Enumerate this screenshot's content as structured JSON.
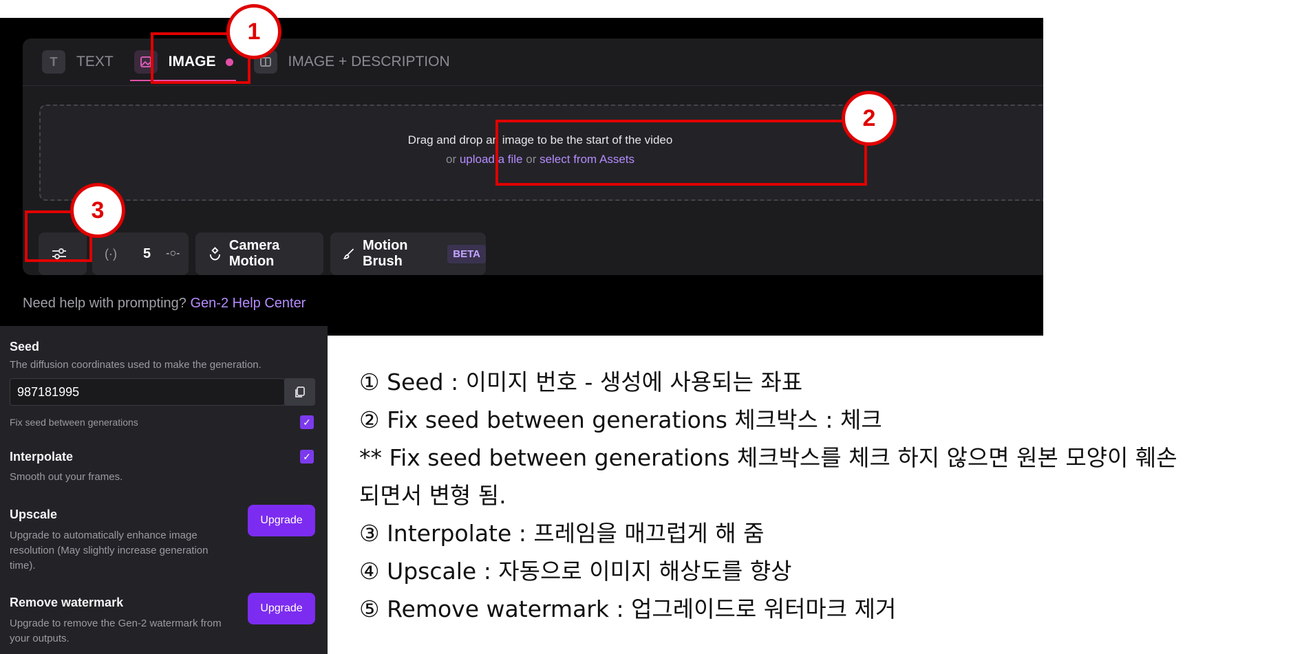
{
  "tabs": [
    {
      "label": "TEXT",
      "icon": "text-icon"
    },
    {
      "label": "IMAGE",
      "icon": "image-icon"
    },
    {
      "label": "IMAGE + DESCRIPTION",
      "icon": "split-layout-icon"
    }
  ],
  "dropzone": {
    "line1": "Drag and drop an image to be the start of the video",
    "or1": "or ",
    "upload": "upload a file",
    "or2": " or ",
    "assets": "select from Assets"
  },
  "toolbar": {
    "duration_paren": "(·)",
    "duration_value": "5",
    "camera_label": "Camera Motion",
    "brush_label": "Motion Brush",
    "beta_badge": "BETA"
  },
  "help": {
    "text": "Need help with prompting? ",
    "link": "Gen-2 Help Center"
  },
  "callouts": {
    "one": "1",
    "two": "2",
    "three": "3"
  },
  "settings": {
    "seed_title": "Seed",
    "seed_desc": "The diffusion coordinates used to make the generation.",
    "seed_value": "987181995",
    "fix_seed_label": "Fix seed between generations",
    "interpolate_title": "Interpolate",
    "interpolate_desc": "Smooth out your frames.",
    "upscale_title": "Upscale",
    "upscale_desc": "Upgrade to automatically enhance image resolution (May slightly increase generation time).",
    "remove_wm_title": "Remove watermark",
    "remove_wm_desc": "Upgrade to remove the Gen-2 watermark from your outputs.",
    "upgrade_label": "Upgrade"
  },
  "notes": [
    "① Seed : 이미지 번호 - 생성에 사용되는 좌표",
    "② Fix seed between generations 체크박스 : 체크",
    " ** Fix seed between generations 체크박스를 체크 하지 않으면 원본 모양이 훼손",
    "되면서 변형 됨.",
    "③ Interpolate : 프레임을 매끄럽게 해 줌",
    "④ Upscale : 자동으로 이미지 해상도를 향상",
    "⑤ Remove watermark : 업그레이드로 워터마크 제거"
  ],
  "colors": {
    "accent_pink": "#e24fa7",
    "accent_purple": "#7c2cf0",
    "link_purple": "#b58cff",
    "callout_red": "#e00000"
  }
}
